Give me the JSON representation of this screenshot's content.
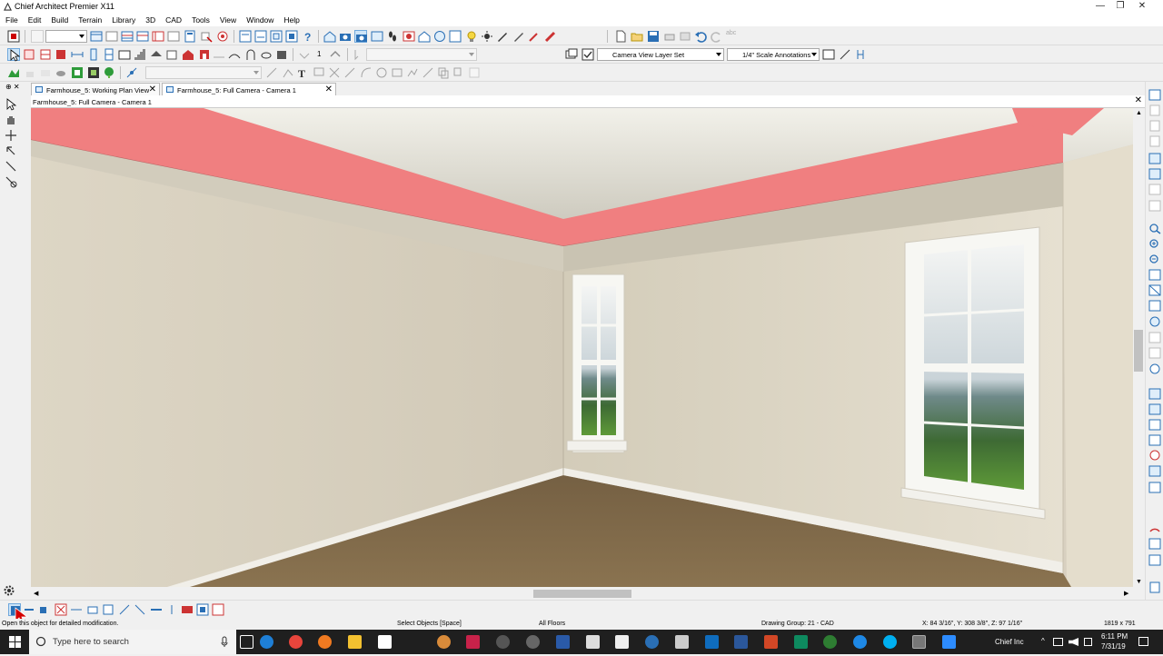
{
  "window": {
    "title": "Chief Architect Premier X11",
    "minimize_glyph": "—",
    "maximize_glyph": "❐",
    "close_glyph": "✕"
  },
  "menu": [
    "File",
    "Edit",
    "Build",
    "Terrain",
    "Library",
    "3D",
    "CAD",
    "Tools",
    "View",
    "Window",
    "Help"
  ],
  "toolbar1": {
    "undo_label_faded": "abc"
  },
  "toolbar2": {
    "counter_value": "1",
    "layer_set": "Camera View Layer Set",
    "annotation_set": "1/4\" Scale Annotations"
  },
  "tabs": [
    {
      "label": "Farmhouse_5:  Working Plan View",
      "close": "✕"
    },
    {
      "label": "Farmhouse_5: Full Camera - Camera 1",
      "close": "✕"
    }
  ],
  "view": {
    "header": "Farmhouse_5: Full Camera - Camera 1",
    "close": "✕"
  },
  "status": {
    "hint": "Open this object for detailed modification.",
    "mode": "Select Objects [Space]",
    "floors": "All Floors",
    "drawing_group": "Drawing Group: 21 - CAD",
    "coordinates": "X: 84 3/16\", Y: 308 3/8\", Z: 97 1/16\"",
    "resolution": "1819 x 791"
  },
  "taskbar": {
    "search_placeholder": "Type here to search",
    "tray_app": "Chief Inc",
    "time": "6:11 PM",
    "date": "7/31/19",
    "chevron": "^"
  },
  "colors": {
    "molding_highlight": "#f07f80",
    "wall": "#d9d2c1",
    "floor": "#7f6848",
    "ceiling": "#c6c2b4",
    "taskbar": "#1f1f1f"
  }
}
